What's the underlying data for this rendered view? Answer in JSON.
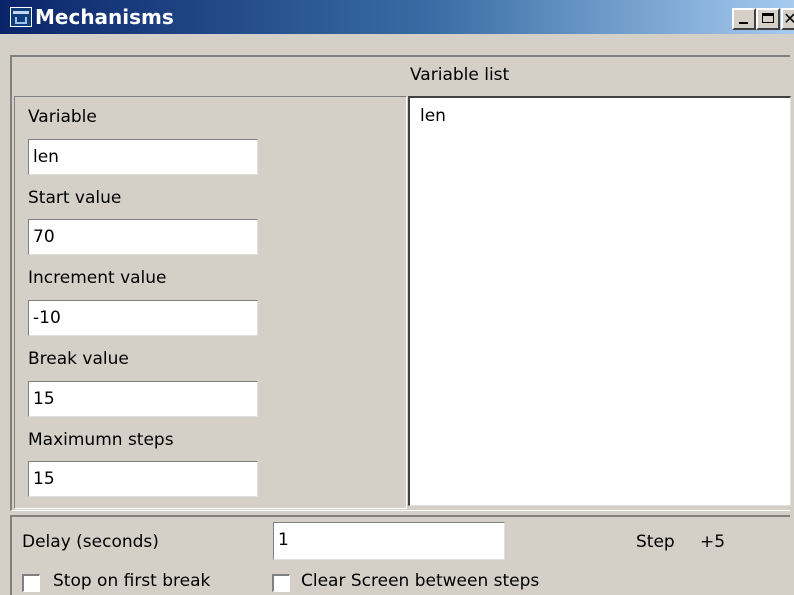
{
  "window": {
    "title": "Mechanisms",
    "minimize_icon": "minimize-icon",
    "maximize_icon": "maximize-icon",
    "close_icon": "close-icon"
  },
  "variable_list": {
    "header": "Variable list",
    "items": [
      "len"
    ]
  },
  "form": {
    "variable": {
      "label": "Variable",
      "value": "len"
    },
    "start_value": {
      "label": "Start value",
      "value": "70"
    },
    "increment_value": {
      "label": "Increment value",
      "value": "-10"
    },
    "break_value": {
      "label": "Break value",
      "value": "15"
    },
    "maximum_steps": {
      "label": "Maximumn steps",
      "value": "15"
    }
  },
  "bottom": {
    "delay_label": "Delay (seconds)",
    "delay_value": "1",
    "step_label": "Step",
    "step_value": "+5",
    "stop_on_first_break": {
      "label": "Stop on first break",
      "checked": false
    },
    "clear_screen": {
      "label": "Clear Screen between steps",
      "checked": false
    }
  }
}
